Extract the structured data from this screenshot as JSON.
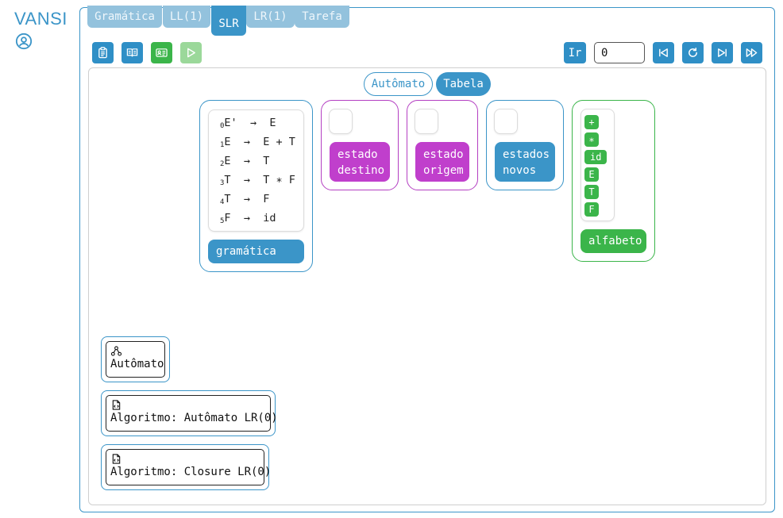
{
  "app": {
    "brand": "VANSI"
  },
  "tabs": [
    {
      "label": "Gramática"
    },
    {
      "label": "LL(1)"
    },
    {
      "label": "SLR",
      "active": true
    },
    {
      "label": "LR(1)"
    },
    {
      "label": "Tarefa"
    }
  ],
  "toolbar": {
    "left_icons": [
      "clipboard-icon",
      "book-icon",
      "id-card-icon",
      "play-icon"
    ],
    "go_label": "Ir",
    "step_value": "0",
    "right_icons": [
      "skip-back-icon",
      "restart-icon",
      "skip-forward-icon",
      "fast-forward-icon"
    ]
  },
  "view_tabs": [
    {
      "label": "Autômato",
      "active": false
    },
    {
      "label": "Tabela",
      "active": true
    }
  ],
  "grammar": {
    "label": "gramática",
    "productions": [
      {
        "idx": "0",
        "lhs": "E'",
        "arrow": "→",
        "rhs": "E"
      },
      {
        "idx": "1",
        "lhs": "E",
        "arrow": "→",
        "rhs": "E + T"
      },
      {
        "idx": "2",
        "lhs": "E",
        "arrow": "→",
        "rhs": "T"
      },
      {
        "idx": "3",
        "lhs": "T",
        "arrow": "→",
        "rhs": "T ∗ F"
      },
      {
        "idx": "4",
        "lhs": "T",
        "arrow": "→",
        "rhs": "F"
      },
      {
        "idx": "5",
        "lhs": "F",
        "arrow": "→",
        "rhs": "id"
      }
    ]
  },
  "target_state": {
    "line1": "estado",
    "line2": "destino"
  },
  "source_state": {
    "line1": "estado",
    "line2": "origem"
  },
  "new_states": {
    "line1": "estados",
    "line2": "novos"
  },
  "alphabet": {
    "label": "alfabeto",
    "symbols": [
      "+",
      "∗",
      "id",
      "E",
      "T",
      "F"
    ]
  },
  "cards": [
    {
      "icon": "network-icon",
      "label": "Autômato"
    },
    {
      "icon": "code-file-icon",
      "label": "Algoritmo: Autômato LR(0)"
    },
    {
      "icon": "code-file-icon",
      "label": "Algoritmo: Closure LR(0)"
    }
  ],
  "colors": {
    "blue": "#3b95c8",
    "magenta": "#c03fcc",
    "green": "#3bb54a"
  }
}
